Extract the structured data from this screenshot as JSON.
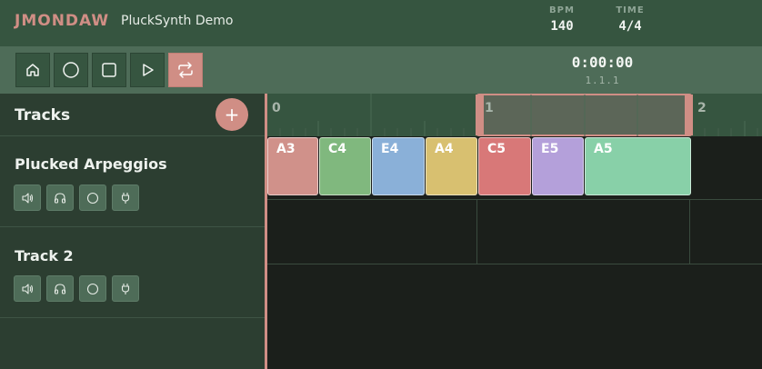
{
  "app": {
    "brand": "JMONDAW",
    "project": "PluckSynth Demo",
    "bpm_label": "BPM",
    "bpm_value": "140",
    "time_label": "TIME",
    "time_value": "4/4"
  },
  "transport": {
    "clock": "0:00:00",
    "position": "1.1.1",
    "buttons": [
      {
        "name": "home-button",
        "icon": "home-icon",
        "active": false
      },
      {
        "name": "record-button",
        "icon": "circle-icon",
        "active": false
      },
      {
        "name": "stop-button",
        "icon": "square-icon",
        "active": false
      },
      {
        "name": "play-button",
        "icon": "play-icon",
        "active": false
      },
      {
        "name": "loop-button",
        "icon": "loop-icon",
        "active": true
      }
    ]
  },
  "sidebar": {
    "title": "Tracks",
    "add_label": "+"
  },
  "tracks": [
    {
      "name": "Plucked Arpeggios",
      "controls": [
        "volume-icon",
        "headphones-icon",
        "circle-icon",
        "plug-icon"
      ]
    },
    {
      "name": "Track 2",
      "controls": [
        "volume-icon",
        "headphones-icon",
        "circle-icon",
        "plug-icon"
      ]
    }
  ],
  "ruler": {
    "bar_labels": [
      "0",
      "1",
      "2"
    ],
    "loop_region_bars": [
      1,
      2
    ]
  },
  "clips": [
    {
      "label": "A3",
      "color": "#d0918a"
    },
    {
      "label": "C4",
      "color": "#80b87e"
    },
    {
      "label": "E4",
      "color": "#8ab0d8"
    },
    {
      "label": "A4",
      "color": "#d8c070"
    },
    {
      "label": "C5",
      "color": "#d87878"
    },
    {
      "label": "E5",
      "color": "#b4a0da"
    },
    {
      "label": "A5",
      "color": "#88d0a8"
    }
  ],
  "colors": {
    "accent": "#d08e85",
    "header": "#365540",
    "toolbar": "#4e6c58",
    "panel": "#2c3e31",
    "lane": "#1b1f1b"
  }
}
